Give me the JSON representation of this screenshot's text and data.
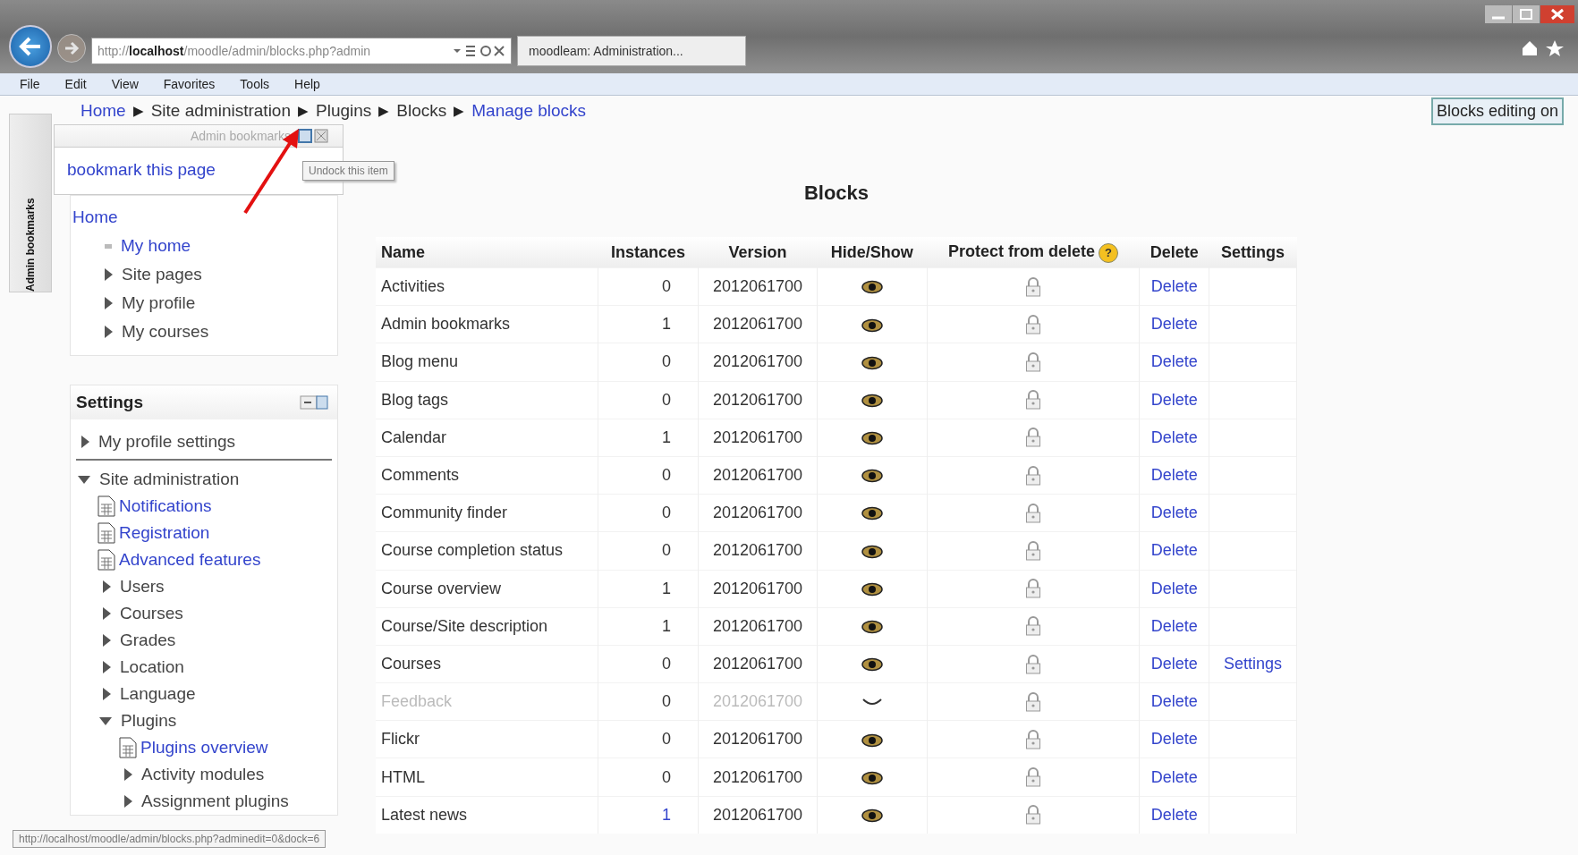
{
  "browser": {
    "address_prefix": "http://",
    "address_host": "localhost",
    "address_rest": "/moodle/admin/blocks.php?admin",
    "tab_title": "moodleam: Administration...",
    "forward_disabled": true
  },
  "menu": [
    "File",
    "Edit",
    "View",
    "Favorites",
    "Tools",
    "Help"
  ],
  "dock": {
    "label": "Admin bookmarks"
  },
  "breadcrumb": [
    {
      "label": "Home",
      "link": true
    },
    {
      "label": "Site administration",
      "link": false
    },
    {
      "label": "Plugins",
      "link": false
    },
    {
      "label": "Blocks",
      "link": false
    },
    {
      "label": "Manage blocks",
      "link": true
    }
  ],
  "breadcrumb_separator": "▶",
  "editing_button": "Blocks editing on",
  "bookmarks_panel": {
    "title": "Admin bookmarks",
    "link": "bookmark this page",
    "tooltip": "Undock this item"
  },
  "navigation": [
    {
      "label": "Home",
      "kind": "link",
      "children": [
        {
          "label": "My home",
          "kind": "bullet"
        },
        {
          "label": "Site pages",
          "kind": "branch",
          "expanded": false
        },
        {
          "label": "My profile",
          "kind": "branch",
          "expanded": false
        },
        {
          "label": "My courses",
          "kind": "branch",
          "expanded": false
        }
      ]
    }
  ],
  "settings": {
    "title": "Settings",
    "items": [
      {
        "label": "My profile settings",
        "kind": "branch",
        "expanded": false
      },
      {
        "label": "Site administration",
        "kind": "branch",
        "expanded": true,
        "children": [
          {
            "label": "Notifications",
            "kind": "page"
          },
          {
            "label": "Registration",
            "kind": "page"
          },
          {
            "label": "Advanced features",
            "kind": "page"
          },
          {
            "label": "Users",
            "kind": "branch",
            "expanded": false
          },
          {
            "label": "Courses",
            "kind": "branch",
            "expanded": false
          },
          {
            "label": "Grades",
            "kind": "branch",
            "expanded": false
          },
          {
            "label": "Location",
            "kind": "branch",
            "expanded": false
          },
          {
            "label": "Language",
            "kind": "branch",
            "expanded": false
          },
          {
            "label": "Plugins",
            "kind": "branch",
            "expanded": true,
            "children": [
              {
                "label": "Plugins overview",
                "kind": "page"
              },
              {
                "label": "Activity modules",
                "kind": "branch",
                "expanded": false
              },
              {
                "label": "Assignment plugins",
                "kind": "branch",
                "expanded": false
              }
            ]
          }
        ]
      }
    ]
  },
  "main": {
    "title": "Blocks",
    "help": "?",
    "columns": [
      "Name",
      "Instances",
      "Version",
      "Hide/Show",
      "Protect from delete",
      "Delete",
      "Settings"
    ],
    "rows": [
      {
        "name": "Activities",
        "instances": "0",
        "instances_link": false,
        "version": "2012061700",
        "visible": true,
        "delete": "Delete"
      },
      {
        "name": "Admin bookmarks",
        "instances": "1",
        "instances_link": false,
        "version": "2012061700",
        "visible": true,
        "delete": "Delete"
      },
      {
        "name": "Blog menu",
        "instances": "0",
        "instances_link": false,
        "version": "2012061700",
        "visible": true,
        "delete": "Delete"
      },
      {
        "name": "Blog tags",
        "instances": "0",
        "instances_link": false,
        "version": "2012061700",
        "visible": true,
        "delete": "Delete"
      },
      {
        "name": "Calendar",
        "instances": "1",
        "instances_link": false,
        "version": "2012061700",
        "visible": true,
        "delete": "Delete"
      },
      {
        "name": "Comments",
        "instances": "0",
        "instances_link": false,
        "version": "2012061700",
        "visible": true,
        "delete": "Delete"
      },
      {
        "name": "Community finder",
        "instances": "0",
        "instances_link": false,
        "version": "2012061700",
        "visible": true,
        "delete": "Delete"
      },
      {
        "name": "Course completion status",
        "instances": "0",
        "instances_link": false,
        "version": "2012061700",
        "visible": true,
        "delete": "Delete"
      },
      {
        "name": "Course overview",
        "instances": "1",
        "instances_link": false,
        "version": "2012061700",
        "visible": true,
        "delete": "Delete"
      },
      {
        "name": "Course/Site description",
        "instances": "1",
        "instances_link": false,
        "version": "2012061700",
        "visible": true,
        "delete": "Delete"
      },
      {
        "name": "Courses",
        "instances": "0",
        "instances_link": false,
        "version": "2012061700",
        "visible": true,
        "delete": "Delete",
        "settings": "Settings"
      },
      {
        "name": "Feedback",
        "instances": "0",
        "instances_link": false,
        "version": "2012061700",
        "visible": false,
        "delete": "Delete"
      },
      {
        "name": "Flickr",
        "instances": "0",
        "instances_link": false,
        "version": "2012061700",
        "visible": true,
        "delete": "Delete"
      },
      {
        "name": "HTML",
        "instances": "0",
        "instances_link": false,
        "version": "2012061700",
        "visible": true,
        "delete": "Delete"
      },
      {
        "name": "Latest news",
        "instances": "1",
        "instances_link": true,
        "version": "2012061700",
        "visible": true,
        "delete": "Delete"
      }
    ]
  },
  "status_url": "http://localhost/moodle/admin/blocks.php?adminedit=0&dock=6"
}
